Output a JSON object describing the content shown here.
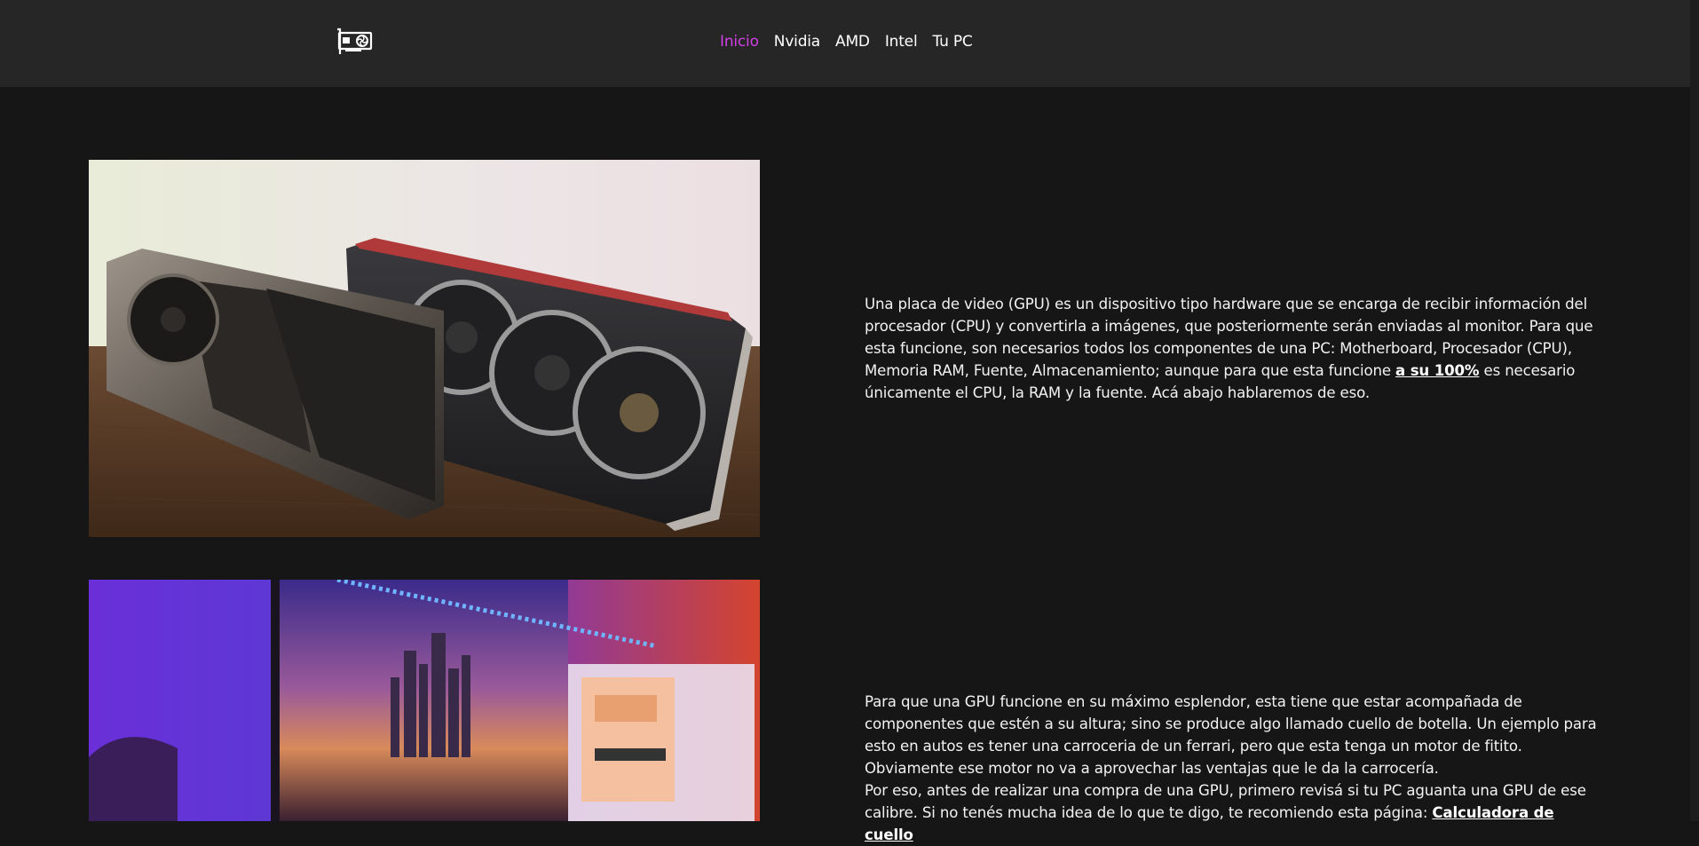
{
  "nav": {
    "items": [
      {
        "label": "Inicio",
        "active": true
      },
      {
        "label": "Nvidia",
        "active": false
      },
      {
        "label": "AMD",
        "active": false
      },
      {
        "label": "Intel",
        "active": false
      },
      {
        "label": "Tu PC",
        "active": false
      }
    ],
    "active_color": "#d13fe6",
    "logo_icon": "graphics-card-icon"
  },
  "section1": {
    "image_icon": "gpu-photo",
    "text_before": "Una placa de video (GPU) es un dispositivo tipo hardware que se encarga de recibir información del procesador (CPU) y convertirla a imágenes, que posteriormente serán enviadas al monitor. Para que esta funcione, son necesarios todos los componentes de una PC: Motherboard, Procesador (CPU), Memoria RAM, Fuente, Almacenamiento; aunque para que esta funcione ",
    "link_label": "a su 100%",
    "text_after": " es necesario únicamente el CPU, la RAM y la fuente. Acá abajo hablaremos de eso."
  },
  "section2": {
    "image_icon": "pc-setup-photo",
    "paragraph1": "Para que una GPU funcione en su máximo esplendor, esta tiene que estar acompañada de componentes que estén a su altura; sino se produce algo llamado cuello de botella. Un ejemplo para esto en autos es tener una carroceria de un ferrari, pero que esta tenga un motor de fitito. Obviamente ese motor no va a aprovechar las ventajas que le da la carrocería.",
    "paragraph2_before": "Por eso, antes de realizar una compra de una GPU, primero revisá si tu PC aguanta una GPU de ese calibre. Si no tenés mucha idea de lo que te digo, te recomiendo esta página: ",
    "link_label": "Calculadora de cuello"
  }
}
